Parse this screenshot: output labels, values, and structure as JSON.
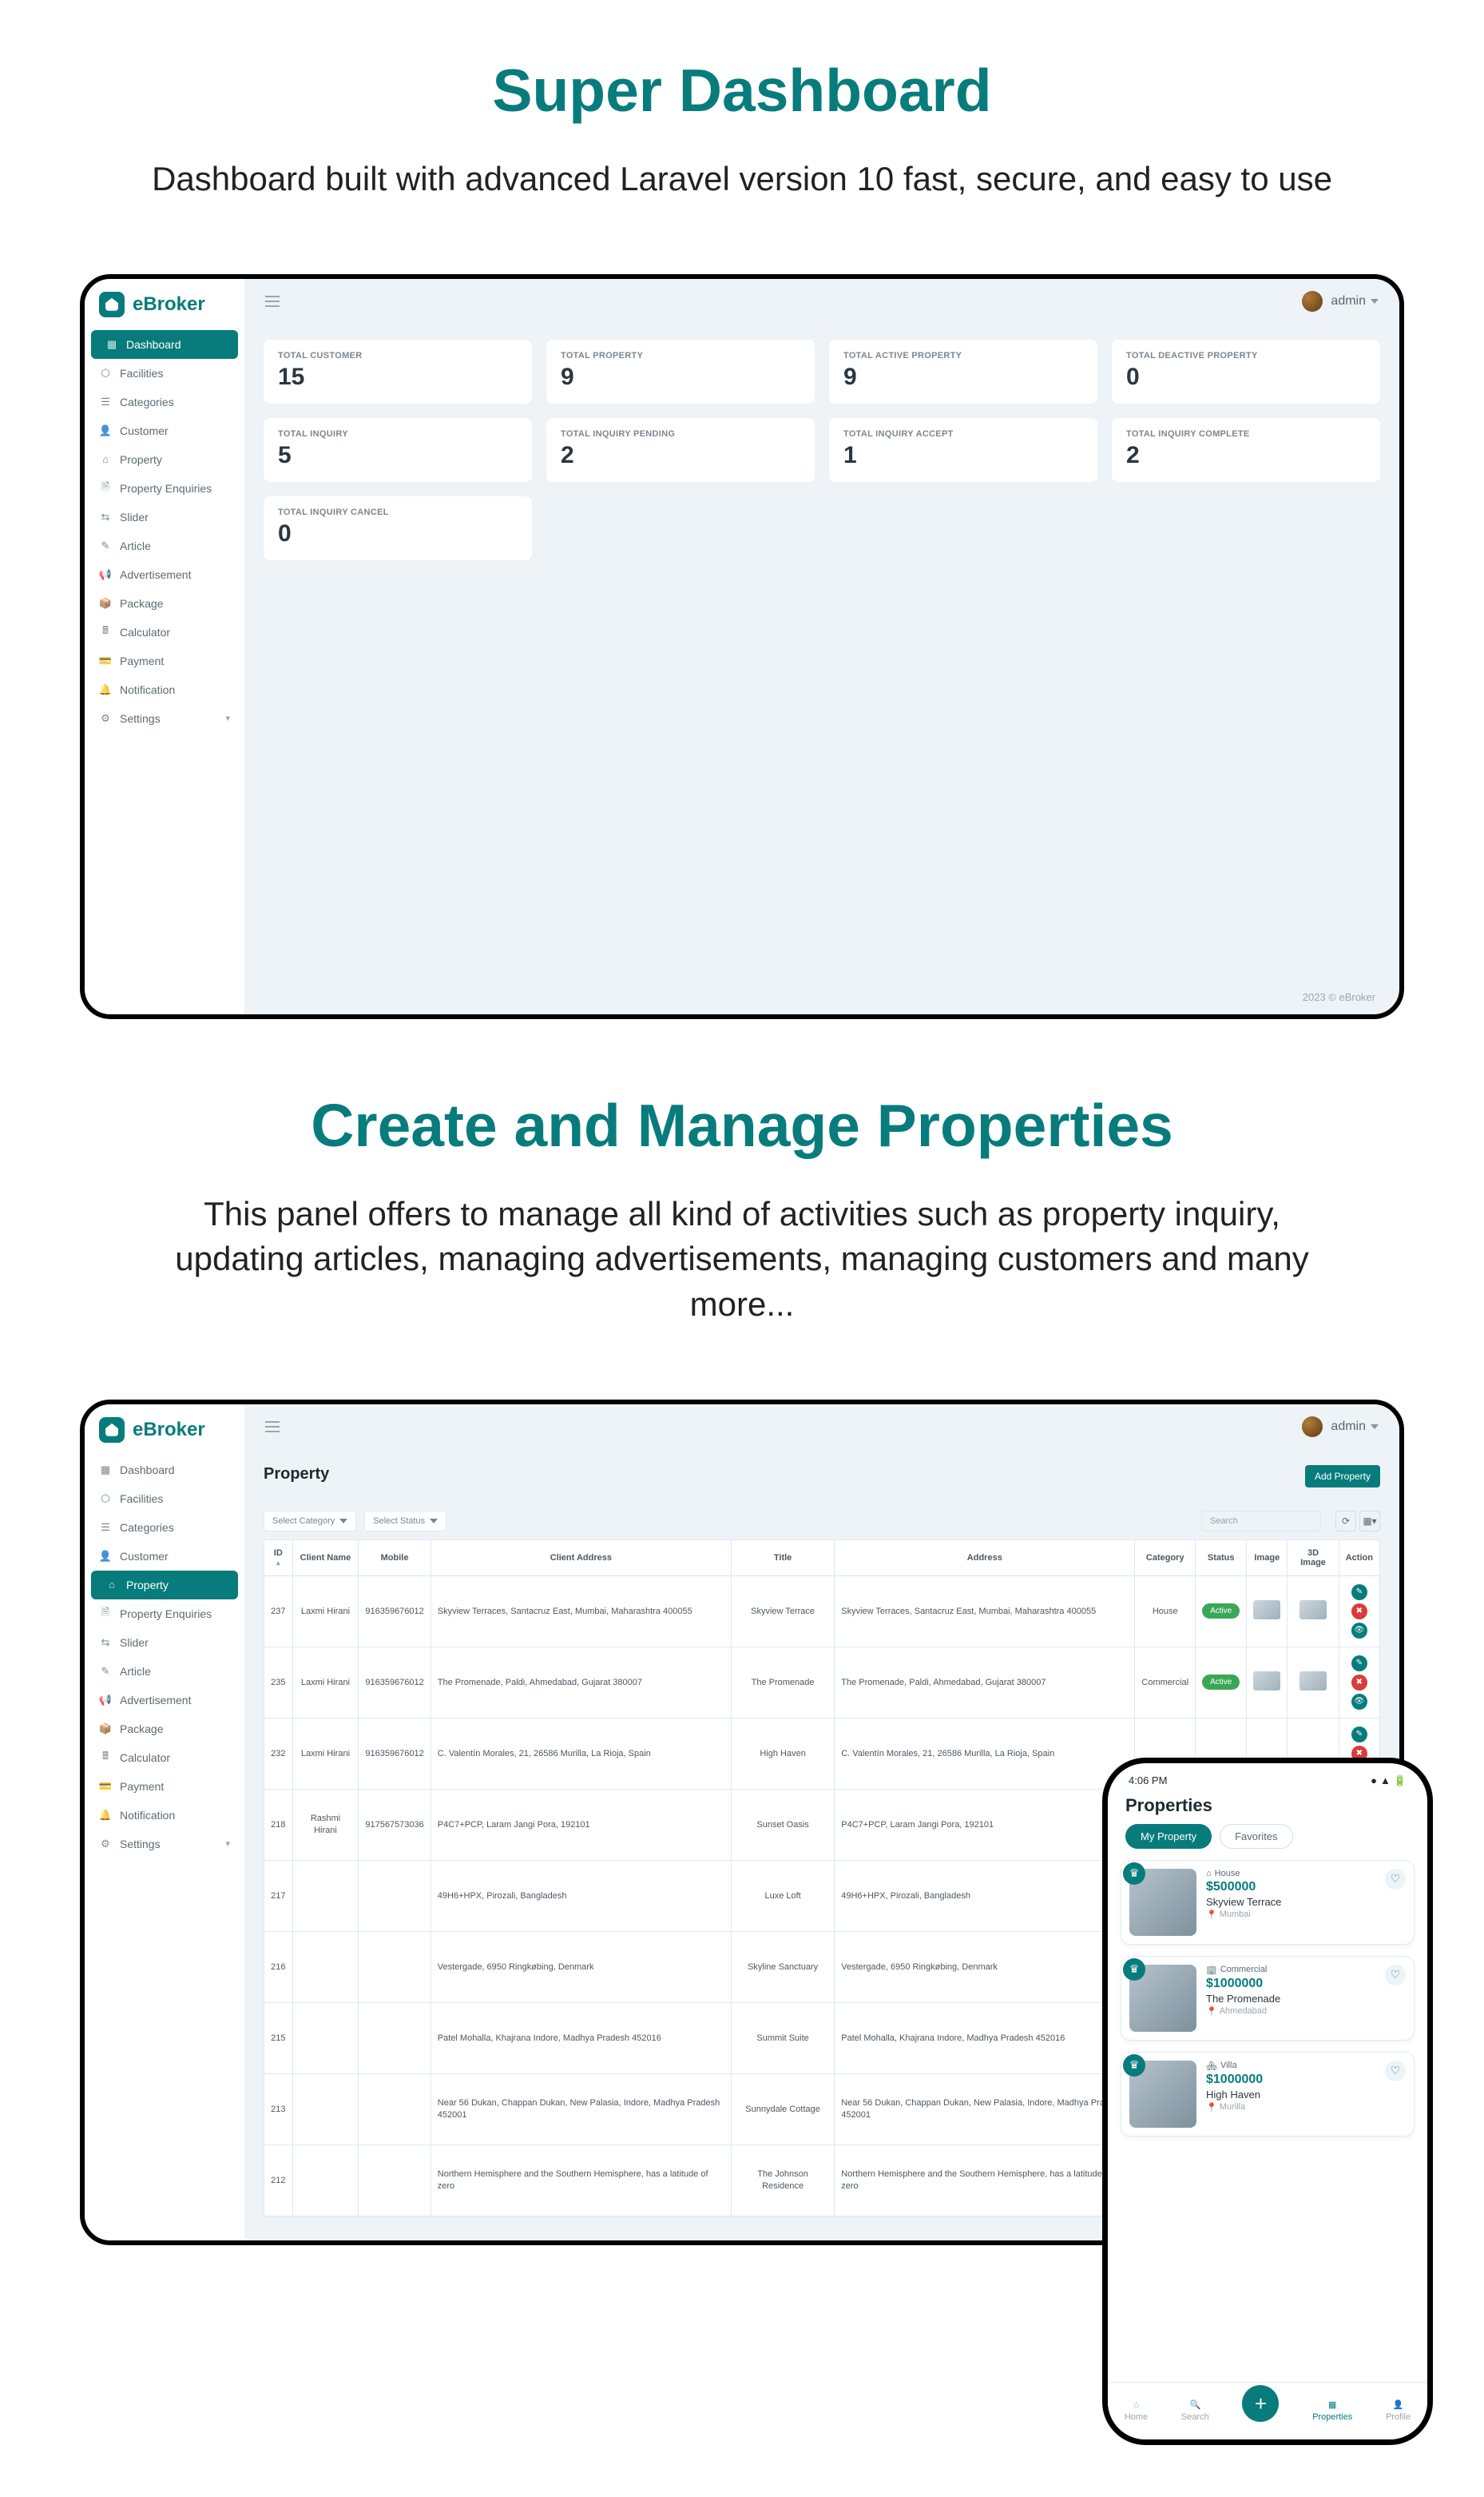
{
  "headlines": {
    "dashboard_title": "Super Dashboard",
    "dashboard_sub": "Dashboard built with advanced Laravel version 10 fast, secure, and easy to use",
    "properties_title": "Create and Manage Properties",
    "properties_sub": "This panel offers to manage all kind of activities such as property inquiry, updating articles, managing advertisements, managing customers and many more..."
  },
  "brand": "eBroker",
  "topbar": {
    "user": "admin"
  },
  "footer": "2023 © eBroker",
  "nav": [
    {
      "icon": "▦",
      "label": "Dashboard"
    },
    {
      "icon": "⬡",
      "label": "Facilities"
    },
    {
      "icon": "☰",
      "label": "Categories"
    },
    {
      "icon": "👤",
      "label": "Customer"
    },
    {
      "icon": "⌂",
      "label": "Property"
    },
    {
      "icon": "🗎",
      "label": "Property Enquiries"
    },
    {
      "icon": "⇆",
      "label": "Slider"
    },
    {
      "icon": "✎",
      "label": "Article"
    },
    {
      "icon": "📢",
      "label": "Advertisement"
    },
    {
      "icon": "📦",
      "label": "Package"
    },
    {
      "icon": "🖩",
      "label": "Calculator"
    },
    {
      "icon": "💳",
      "label": "Payment"
    },
    {
      "icon": "🔔",
      "label": "Notification"
    },
    {
      "icon": "⚙",
      "label": "Settings",
      "chevron": true
    }
  ],
  "dash": {
    "row1": [
      {
        "label": "TOTAL CUSTOMER",
        "value": "15"
      },
      {
        "label": "TOTAL PROPERTY",
        "value": "9"
      },
      {
        "label": "TOTAL ACTIVE PROPERTY",
        "value": "9"
      },
      {
        "label": "TOTAL DEACTIVE PROPERTY",
        "value": "0"
      }
    ],
    "row2": [
      {
        "label": "TOTAL INQUIRY",
        "value": "5"
      },
      {
        "label": "TOTAL INQUIRY PENDING",
        "value": "2"
      },
      {
        "label": "TOTAL INQUIRY ACCEPT",
        "value": "1"
      },
      {
        "label": "TOTAL INQUIRY COMPLETE",
        "value": "2"
      }
    ],
    "row3": [
      {
        "label": "TOTAL INQUIRY CANCEL",
        "value": "0"
      }
    ]
  },
  "props": {
    "page_title": "Property",
    "add_btn": "Add Property",
    "filters": {
      "category": "Select Category",
      "status": "Select Status"
    },
    "search_placeholder": "Search",
    "columns": [
      "ID",
      "Client Name",
      "Mobile",
      "Client Address",
      "Title",
      "Address",
      "Category",
      "Status",
      "Image",
      "3D Image",
      "Action"
    ],
    "rows": [
      {
        "id": "237",
        "client": "Laxmi Hirani",
        "mobile": "916359676012",
        "caddr": "Skyview Terraces, Santacruz East, Mumbai, Maharashtra 400055",
        "title": "Skyview Terrace",
        "addr": "Skyview Terraces, Santacruz East, Mumbai, Maharashtra 400055",
        "category": "House",
        "status": "Active"
      },
      {
        "id": "235",
        "client": "Laxmi Hirani",
        "mobile": "916359676012",
        "caddr": "The Promenade, Paldi, Ahmedabad, Gujarat 380007",
        "title": "The Promenade",
        "addr": "The Promenade, Paldi, Ahmedabad, Gujarat 380007",
        "category": "Commercial",
        "status": "Active"
      },
      {
        "id": "232",
        "client": "Laxmi Hirani",
        "mobile": "916359676012",
        "caddr": "C. Valentín Morales, 21, 26586 Murilla, La Rioja, Spain",
        "title": "High Haven",
        "addr": "C. Valentín Morales, 21, 26586 Murilla, La Rioja, Spain",
        "category": "",
        "status": ""
      },
      {
        "id": "218",
        "client": "Rashmi Hirani",
        "mobile": "917567573036",
        "caddr": "P4C7+PCP, Laram Jangi Pora, 192101",
        "title": "Sunset Oasis",
        "addr": "P4C7+PCP, Laram Jangi Pora, 192101",
        "category": "",
        "status": ""
      },
      {
        "id": "217",
        "client": "",
        "mobile": "",
        "caddr": "49H6+HPX, Pirozali, Bangladesh",
        "title": "Luxe Loft",
        "addr": "49H6+HPX, Pirozali, Bangladesh",
        "category": "",
        "status": ""
      },
      {
        "id": "216",
        "client": "",
        "mobile": "",
        "caddr": "Vestergade, 6950 Ringkøbing, Denmark",
        "title": "Skyline Sanctuary",
        "addr": "Vestergade, 6950 Ringkøbing, Denmark",
        "category": "",
        "status": ""
      },
      {
        "id": "215",
        "client": "",
        "mobile": "",
        "caddr": "Patel Mohalla, Khajrana Indore, Madhya Pradesh 452016",
        "title": "Summit Suite",
        "addr": "Patel Mohalla, Khajrana Indore, Madhya Pradesh 452016",
        "category": "",
        "status": ""
      },
      {
        "id": "213",
        "client": "",
        "mobile": "",
        "caddr": "Near 56 Dukan, Chappan Dukan, New Palasia, Indore, Madhya Pradesh 452001",
        "title": "Sunnydale Cottage",
        "addr": "Near 56 Dukan, Chappan Dukan, New Palasia, Indore, Madhya Pradesh 452001",
        "category": "",
        "status": ""
      },
      {
        "id": "212",
        "client": "",
        "mobile": "",
        "caddr": "Northern Hemisphere and the Southern Hemisphere, has a latitude of zero",
        "title": "The Johnson Residence",
        "addr": "Northern Hemisphere and the Southern Hemisphere, has a latitude of zero",
        "category": "",
        "status": ""
      }
    ]
  },
  "phone": {
    "time": "4:06 PM",
    "title": "Properties",
    "tabs": {
      "mine": "My Property",
      "fav": "Favorites"
    },
    "items": [
      {
        "type_icon": "⌂",
        "type": "House",
        "price": "$500000",
        "name": "Skyview Terrace",
        "loc": "Mumbai"
      },
      {
        "type_icon": "🏢",
        "type": "Commercial",
        "price": "$1000000",
        "name": "The Promenade",
        "loc": "Ahmedabad"
      },
      {
        "type_icon": "🏘",
        "type": "Villa",
        "price": "$1000000",
        "name": "High Haven",
        "loc": "Murilla"
      }
    ],
    "tabbar": [
      {
        "icon": "⌂",
        "label": "Home"
      },
      {
        "icon": "🔍",
        "label": "Search"
      },
      {
        "icon": "+",
        "label": "",
        "fab": true
      },
      {
        "icon": "▦",
        "label": "Properties",
        "active": true
      },
      {
        "icon": "👤",
        "label": "Profile"
      }
    ]
  }
}
